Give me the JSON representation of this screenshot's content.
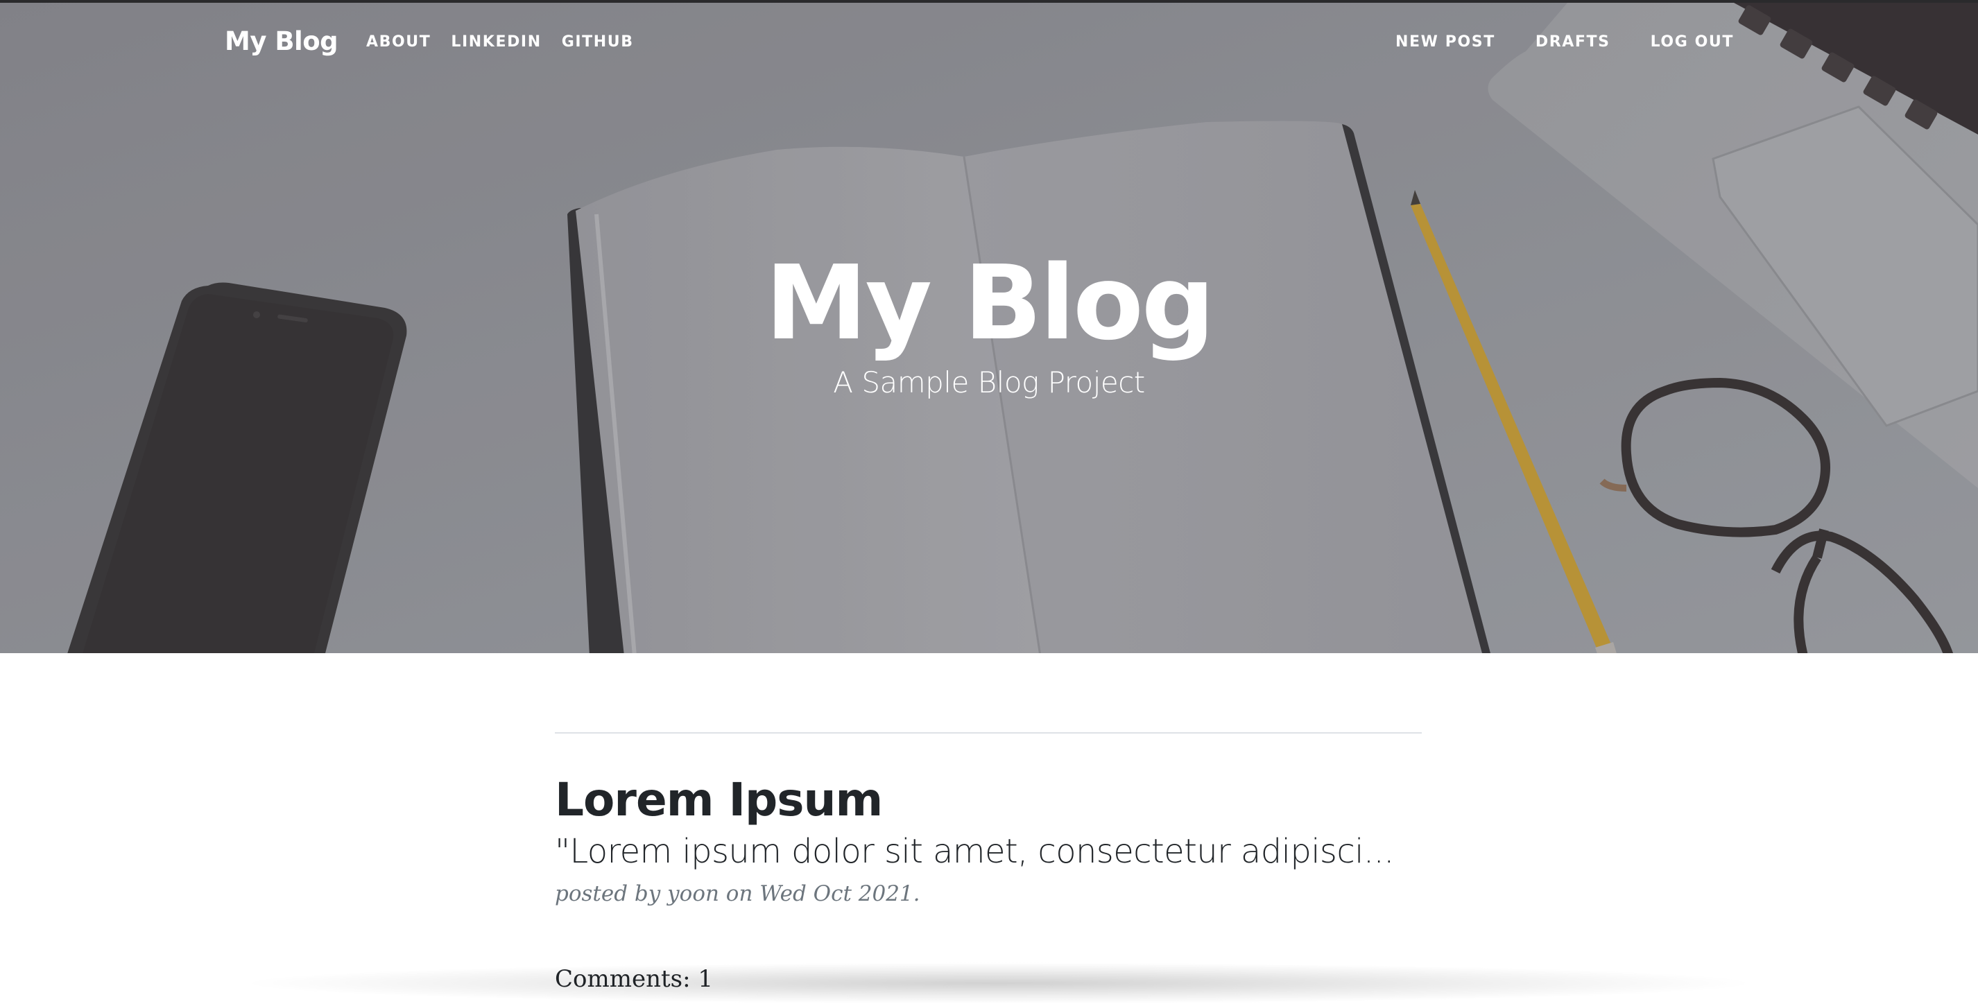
{
  "nav": {
    "brand": "My Blog",
    "left_links": [
      {
        "label": "About"
      },
      {
        "label": "LinkedIn"
      },
      {
        "label": "Github"
      }
    ],
    "right_links": [
      {
        "label": "New Post"
      },
      {
        "label": "Drafts"
      },
      {
        "label": "Log Out"
      }
    ]
  },
  "hero": {
    "title": "My Blog",
    "subtitle": "A Sample Blog Project"
  },
  "posts": [
    {
      "title": "Lorem Ipsum",
      "subtitle": "\"Lorem ipsum dolor sit amet, consectetur adipisci...",
      "meta_prefix": "posted by ",
      "author": "yoon",
      "meta_suffix": " on Wed Oct 2021.",
      "comments": "Comments: 1"
    }
  ],
  "colors": {
    "text_dark": "#212529",
    "text_muted": "#6c757d",
    "divider": "#dee2e6",
    "hero_text": "#ffffff"
  },
  "icons": {
    "hero_background": "desk-photo-phone-notebook-pencil-glasses-laptop"
  }
}
